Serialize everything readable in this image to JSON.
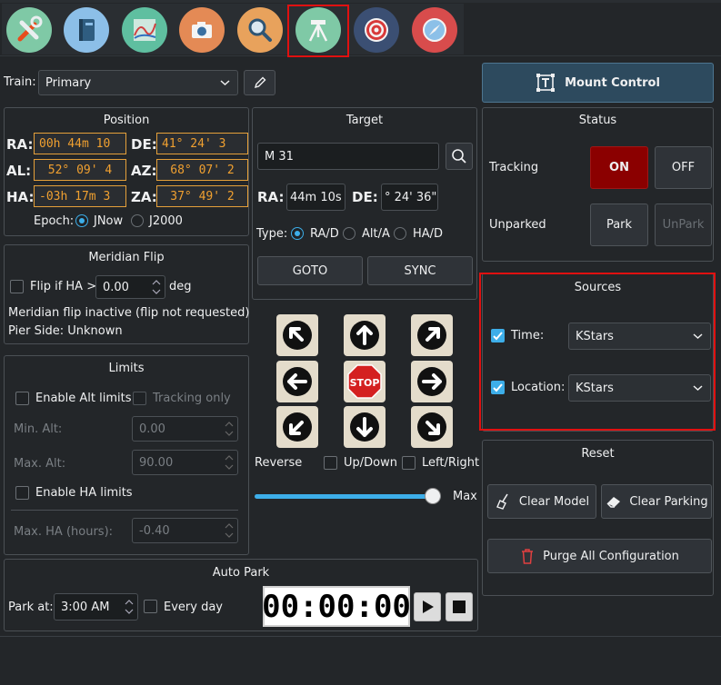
{
  "toolbar": {
    "modules": [
      {
        "icon": "tools-icon"
      },
      {
        "icon": "notebook-icon"
      },
      {
        "icon": "chart-icon"
      },
      {
        "icon": "camera-icon"
      },
      {
        "icon": "magnifier-icon"
      },
      {
        "icon": "tripod-mount-icon"
      },
      {
        "icon": "target-icon"
      },
      {
        "icon": "compass-icon"
      }
    ],
    "selected": "tripod-mount-icon"
  },
  "train": {
    "label": "Train:",
    "value": "Primary"
  },
  "mount_control_label": "Mount Control",
  "position": {
    "title": "Position",
    "ra_label": "RA:",
    "ra": "00h 44m 10",
    "de_label": "DE:",
    "de": "41° 24' 3",
    "al_label": "AL:",
    "al": "52° 09' 4",
    "az_label": "AZ:",
    "az": "68° 07' 2",
    "ha_label": "HA:",
    "ha": "-03h 17m 3",
    "za_label": "ZA:",
    "za": "37° 49' 2",
    "epoch_label": "Epoch:",
    "jnow": "JNow",
    "j2000": "J2000"
  },
  "target": {
    "title": "Target",
    "search_value": "M 31",
    "ra_label": "RA:",
    "ra": "44m 10s",
    "de_label": "DE:",
    "de": "° 24' 36\"",
    "type_label": "Type:",
    "type_rade": "RA/D",
    "type_alta": "Alt/A",
    "type_hade": "HA/D",
    "goto": "GOTO",
    "sync": "SYNC"
  },
  "meridian": {
    "title": "Meridian Flip",
    "flip_label": "Flip if HA >:",
    "flip_value": "0.00",
    "unit": "deg",
    "status": "Meridian flip inactive (flip not requested)",
    "pier": "Pier Side: Unknown"
  },
  "limits": {
    "title": "Limits",
    "enable_alt": "Enable Alt limits",
    "tracking_only": "Tracking only",
    "min_alt_label": "Min. Alt:",
    "min_alt": "0.00",
    "max_alt_label": "Max. Alt:",
    "max_alt": "90.00",
    "enable_ha": "Enable HA limits",
    "max_ha_label": "Max. HA (hours):",
    "max_ha": "-0.40"
  },
  "motion": {
    "stop": "STOP",
    "reverse": "Reverse",
    "updown": "Up/Down",
    "leftright": "Left/Right",
    "speed_label": "Max",
    "speed_fraction": 1.0
  },
  "autopark": {
    "title": "Auto Park",
    "park_at_label": "Park at:",
    "park_at": "3:00 AM",
    "every_day": "Every day",
    "timer": "00:00:00"
  },
  "status": {
    "title": "Status",
    "tracking_label": "Tracking",
    "on": "ON",
    "off": "OFF",
    "unparked_label": "Unparked",
    "park": "Park",
    "unpark": "UnPark"
  },
  "sources": {
    "title": "Sources",
    "time_label": "Time:",
    "time_value": "KStars",
    "location_label": "Location:",
    "location_value": "KStars"
  },
  "reset": {
    "title": "Reset",
    "clear_model": "Clear  Model",
    "clear_parking": "Clear Parking",
    "purge": "Purge All Configuration"
  },
  "colors": {
    "accent": "#3daee9",
    "lcd": "#f0a030",
    "tracking_on": "#8b0000",
    "highlight": "#e01010"
  }
}
